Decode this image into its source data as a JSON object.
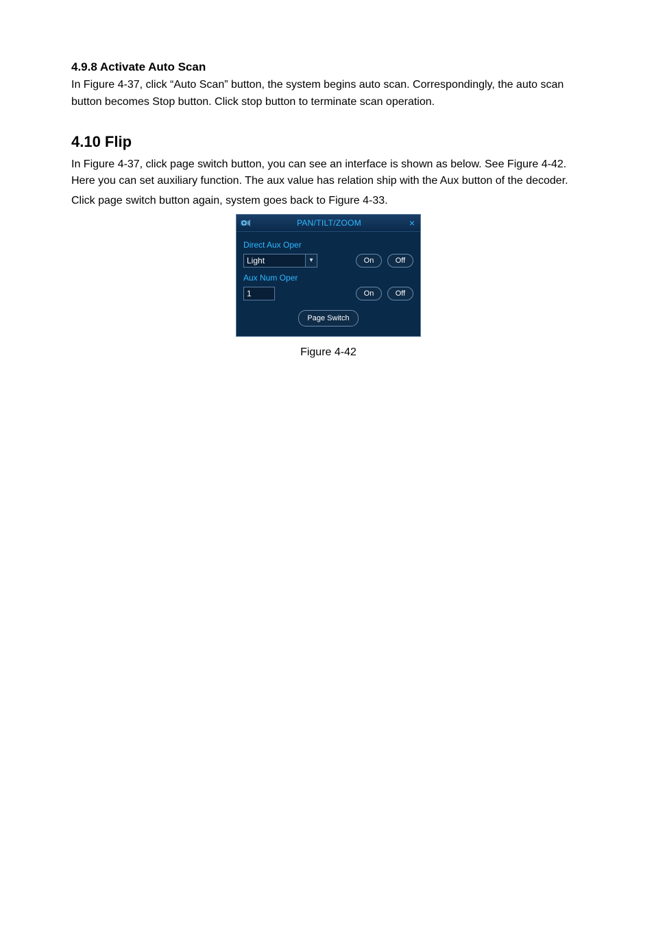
{
  "section498": {
    "heading": "4.9.8 Activate Auto Scan",
    "paragraph": "In Figure 4-37, click “Auto Scan” button, the system begins auto scan. Correspondingly, the auto scan button becomes Stop button. Click stop button to terminate scan operation."
  },
  "section410": {
    "heading": "4.10 Flip",
    "paragraph1": "In Figure 4-37, click page switch button, you can see an interface is shown as below. See Figure 4-42. Here you can set auxiliary function. The aux value has relation ship with the Aux button of the decoder.",
    "paragraph2": "Click page switch button again, system goes back to Figure 4-33."
  },
  "panel": {
    "title": "PAN/TILT/ZOOM",
    "close": "×",
    "direct_label": "Direct Aux Oper",
    "direct_select_value": "Light",
    "aux_label": "Aux Num Oper",
    "aux_num_value": "1",
    "on": "On",
    "off": "Off",
    "page_switch": "Page Switch"
  },
  "figure_caption": "Figure 4-42"
}
